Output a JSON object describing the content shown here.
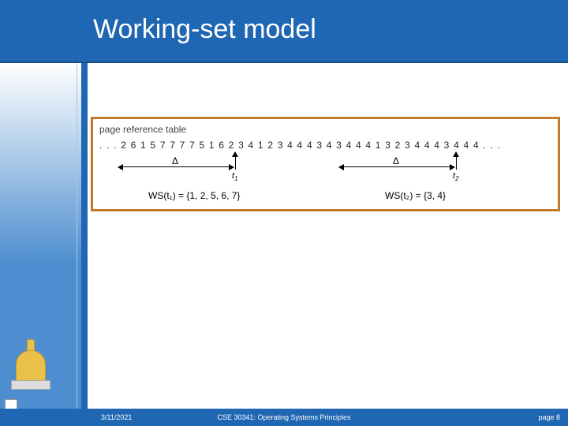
{
  "title": "Working-set model",
  "figure": {
    "caption": "page reference table",
    "reference_string": ". . . 2 6 1 5 7 7 7 7 5 1 6 2 3 4 1 2 3 4 4 4 3 4 3 4 4 4 1 3 2 3 4 4 4 3 4 4 4 . . .",
    "delta_label_1": "Δ",
    "delta_label_2": "Δ",
    "t1_label_html": "t<sub>1</sub>",
    "t2_label_html": "t<sub>2</sub>",
    "ws1": "WS(t₁) = {1, 2, 5, 6, 7}",
    "ws2": "WS(t₂) = {3, 4}"
  },
  "footer": {
    "date": "3/11/2021",
    "course": "CSE 30341: Operating Systems Principles",
    "page": "page 8"
  }
}
